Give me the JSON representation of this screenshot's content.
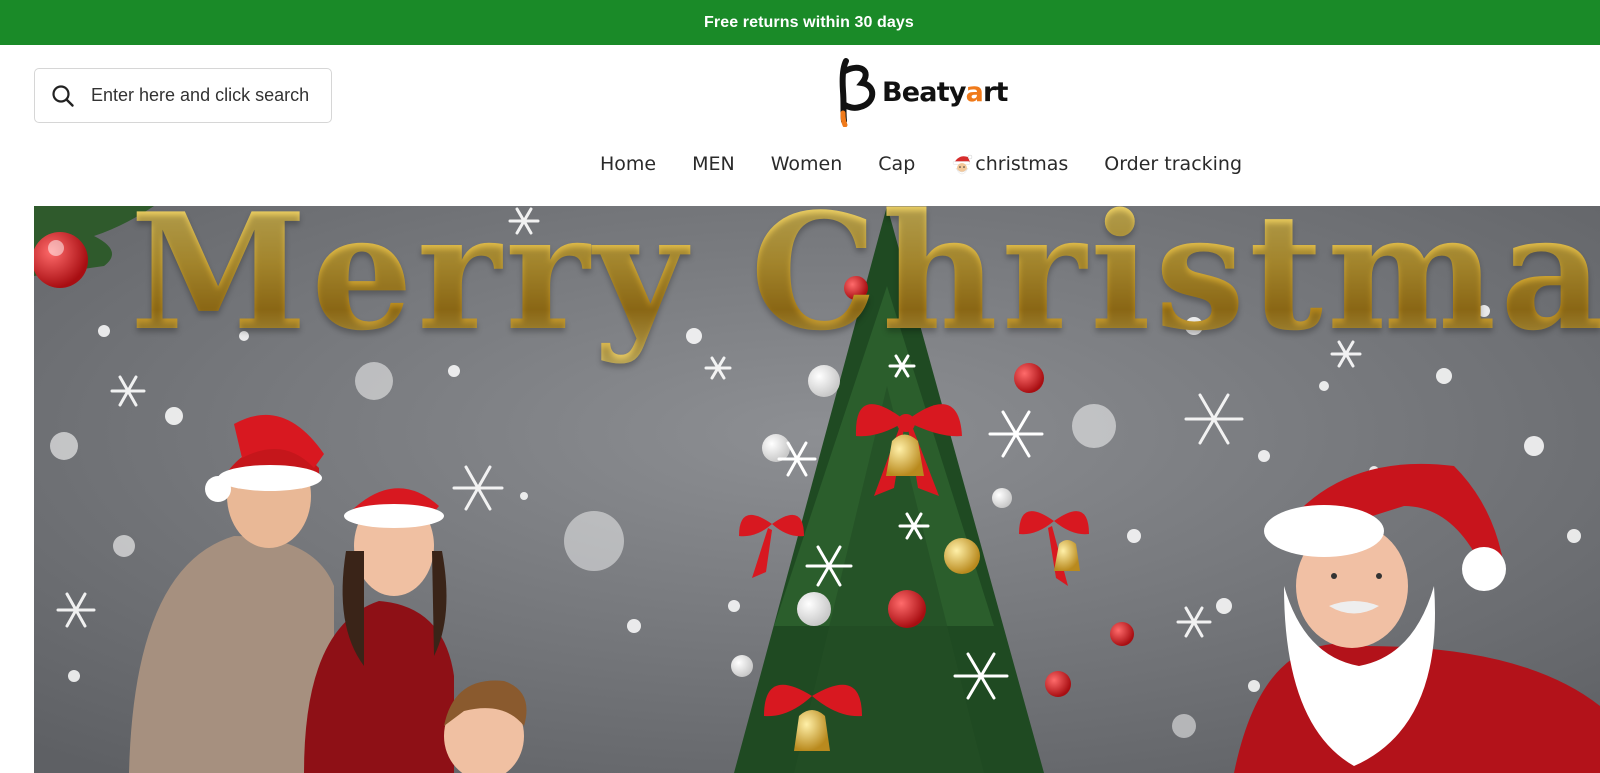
{
  "announcement": {
    "text": "Free returns within 30 days"
  },
  "search": {
    "placeholder": "Enter here and click search",
    "icon": "search-icon"
  },
  "logo": {
    "prefix": "Beaty",
    "accent": "a",
    "suffix": "rt",
    "accent_color": "#f07a1a"
  },
  "nav": {
    "items": [
      {
        "label": "Home"
      },
      {
        "label": "MEN"
      },
      {
        "label": "Women"
      },
      {
        "label": "Cap"
      },
      {
        "label": "christmas",
        "icon": "santa-icon"
      },
      {
        "label": "Order tracking"
      }
    ]
  },
  "banner": {
    "title": "Merry Christmas"
  },
  "colors": {
    "announcement_bg": "#1a8a28",
    "banner_bg": "#76787c",
    "gold": "#d9b13b",
    "santa_red": "#c8141c"
  }
}
